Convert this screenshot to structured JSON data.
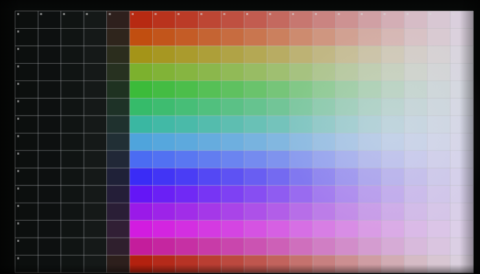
{
  "grid": {
    "columns": 20,
    "rows": 15,
    "dark_columns": 5,
    "line_color": "#b9bcbf",
    "dark_column_colors": [
      "#0c0f0e",
      "#0d1010",
      "#101413",
      "#151918",
      "#1b1f1e"
    ],
    "row_hues": [
      {
        "name": "red",
        "color": "#b72a12"
      },
      {
        "name": "orange",
        "color": "#c14e10"
      },
      {
        "name": "yellow-olive",
        "color": "#a49418"
      },
      {
        "name": "yellow-green",
        "color": "#7cb12e"
      },
      {
        "name": "green",
        "color": "#3cbb3a"
      },
      {
        "name": "green-cyan",
        "color": "#36bb6a"
      },
      {
        "name": "teal",
        "color": "#3ab7a2"
      },
      {
        "name": "sky-blue",
        "color": "#4fa4dc"
      },
      {
        "name": "blue",
        "color": "#4b6cf2"
      },
      {
        "name": "blue-violet",
        "color": "#3a2cf6"
      },
      {
        "name": "violet",
        "color": "#6416f6"
      },
      {
        "name": "purple",
        "color": "#9a1ae8"
      },
      {
        "name": "magenta",
        "color": "#d21ce0"
      },
      {
        "name": "pink-magenta",
        "color": "#c41d9c"
      },
      {
        "name": "crimson",
        "color": "#b3210f"
      }
    ],
    "fade_color": "#dcd8e8",
    "fade_strength": [
      0.0,
      0.05,
      0.1,
      0.16,
      0.22,
      0.29,
      0.36,
      0.44,
      0.52,
      0.6,
      0.68,
      0.76,
      0.84,
      0.9,
      0.95
    ]
  }
}
